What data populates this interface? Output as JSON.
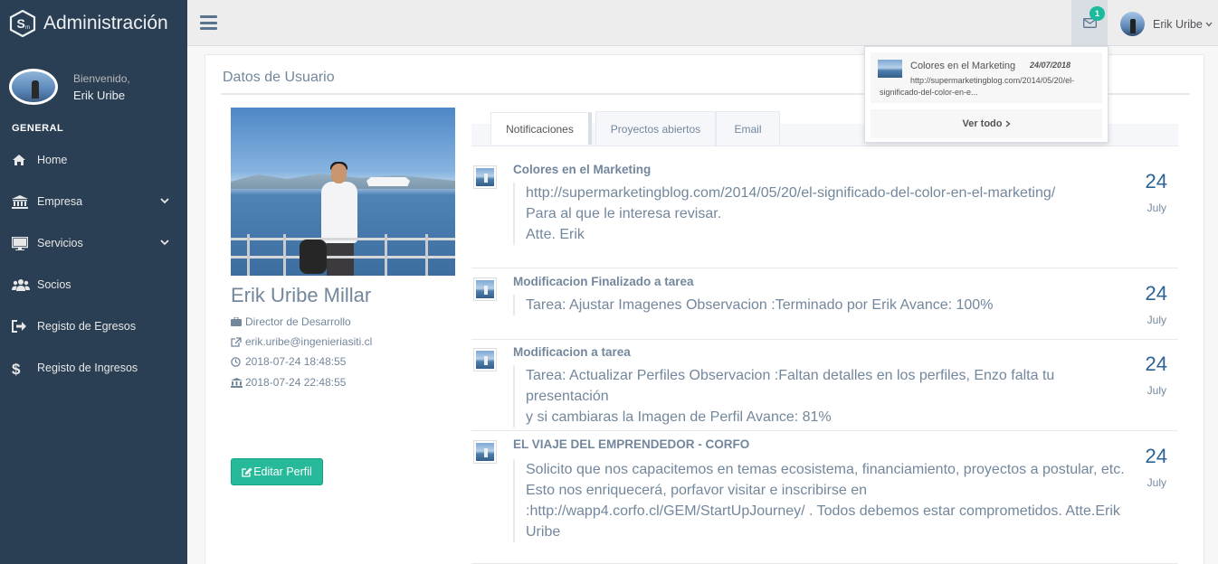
{
  "app": {
    "title": "Administración"
  },
  "sidebar": {
    "welcome": "Bienvenido,",
    "user_name": "Erik Uribe",
    "section": "GENERAL",
    "items": [
      {
        "label": "Home",
        "icon": "home-icon"
      },
      {
        "label": "Empresa",
        "icon": "bank-icon",
        "has_submenu": true
      },
      {
        "label": "Servicios",
        "icon": "desktop-icon",
        "has_submenu": true
      },
      {
        "label": "Socios",
        "icon": "users-icon"
      },
      {
        "label": "Registo de Egresos",
        "icon": "sign-out-icon"
      },
      {
        "label": "Registo de Ingresos",
        "icon": "dollar-icon"
      }
    ]
  },
  "topnav": {
    "mail_count": "1",
    "user_label": "Erik Uribe"
  },
  "dropdown": {
    "item": {
      "title": "Colores en el Marketing",
      "date": "24/07/2018",
      "text": "http://supermarketingblog.com/2014/05/20/el-significado-del-color-en-e..."
    },
    "see_all": "Ver todo"
  },
  "panel": {
    "title": "Datos de Usuario"
  },
  "profile": {
    "full_name": "Erik Uribe Millar",
    "role": "Director de Desarrollo",
    "email": "erik.uribe@ingenieriasiti.cl",
    "date1": "2018-07-24 18:48:55",
    "date2": "2018-07-24 22:48:55",
    "edit_label": "Editar Perfil"
  },
  "tabs": [
    {
      "label": "Notificaciones",
      "active": true
    },
    {
      "label": "Proyectos abiertos",
      "active": false
    },
    {
      "label": "Email",
      "active": false
    }
  ],
  "messages": [
    {
      "title": "Colores en el Marketing",
      "lines": [
        "http://supermarketingblog.com/2014/05/20/el-significado-del-color-en-el-marketing/",
        "Para al que le interesa revisar.",
        "Atte. Erik"
      ],
      "day": "24",
      "month": "July"
    },
    {
      "title": "Modificacion Finalizado a tarea",
      "lines": [
        "Tarea: Ajustar Imagenes Observacion :Terminado por Erik Avance: 100%"
      ],
      "day": "24",
      "month": "July"
    },
    {
      "title": "Modificacion a tarea",
      "lines": [
        "Tarea: Actualizar Perfiles Observacion :Faltan detalles en los perfiles, Enzo falta tu presentación",
        "y si cambiaras la Imagen de Perfil Avance: 81%"
      ],
      "day": "24",
      "month": "July"
    },
    {
      "title": "EL VIAJE DEL EMPRENDEDOR - CORFO",
      "lines": [
        "Solicito que nos capacitemos en temas ecosistema, financiamiento, proyectos a postular, etc.",
        "Esto nos enriquecerá, porfavor visitar e inscribirse en",
        ":http://wapp4.corfo.cl/GEM/StartUpJourney/ . Todos debemos estar comprometidos. Atte.Erik",
        "Uribe"
      ],
      "day": "24",
      "month": "July"
    }
  ],
  "colors": {
    "sidebar_bg": "#2a3f54",
    "accent": "#1abb9c",
    "button": "#26b99a",
    "date_blue": "#2a6496"
  }
}
